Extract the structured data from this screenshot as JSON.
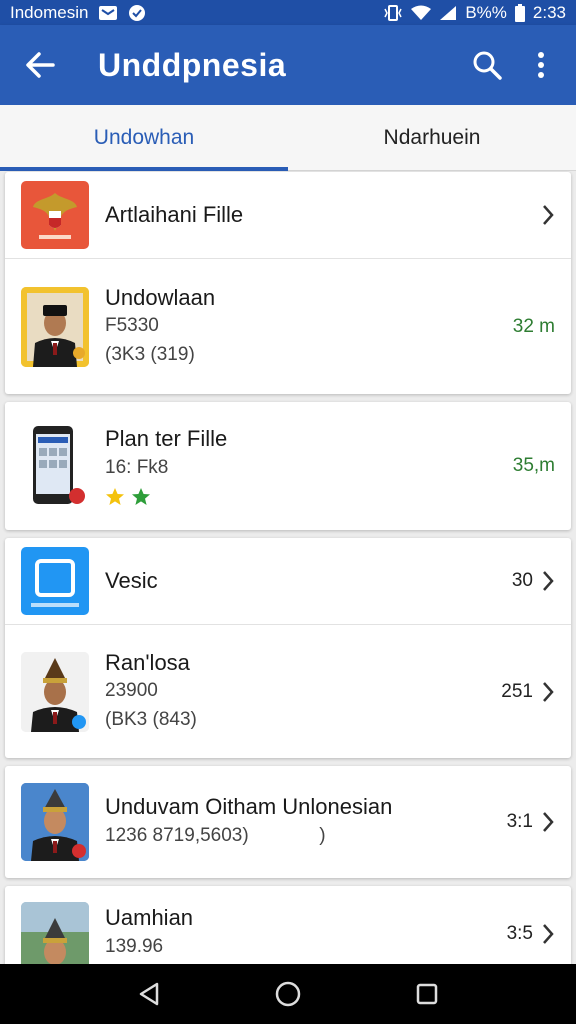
{
  "status_bar": {
    "carrier": "Indomesin",
    "battery": "B%%",
    "time": "2:33"
  },
  "app_bar": {
    "title": "Unddpnesia"
  },
  "tabs": [
    {
      "label": "Undowhan",
      "active": true
    },
    {
      "label": "Ndarhuein",
      "active": false
    }
  ],
  "cards": [
    {
      "rows": [
        {
          "title": "Artlaihani Fille",
          "trailing": "",
          "icon": "garuda-emblem"
        }
      ]
    },
    {
      "rows": [
        {
          "title": "Undowlaan",
          "line1": "F5330",
          "line2": "(3K3 (319)",
          "trailing": "32 m",
          "icon": "person-peci-portrait"
        }
      ]
    },
    {
      "rows": [
        {
          "title": "Plan ter Fille",
          "line1": "16: Fk8",
          "trailing": "35,m",
          "icon": "smartphone",
          "stars": [
            "yellow",
            "green"
          ]
        }
      ]
    },
    {
      "rows": [
        {
          "title": "Vesic",
          "trailing": "30",
          "icon": "blue-square-app"
        },
        {
          "title": "Ran'losa",
          "line1": "23900",
          "line2": "(BK3 (843)",
          "trailing": "251",
          "icon": "person-traditional-hat"
        }
      ]
    },
    {
      "rows": [
        {
          "title": "Unduvam Oitham Unlonesian",
          "line1": "1236 8719,5603)",
          "line2_suffix": ")",
          "trailing": "3:1",
          "icon": "person-traditional-hat-blue"
        }
      ]
    },
    {
      "rows": [
        {
          "title": "Uamhian",
          "line1": "139.96",
          "trailing": "3:5",
          "icon": "person-outdoor"
        }
      ]
    }
  ],
  "colors": {
    "primary": "#2a5db6",
    "status": "#1f4fa6",
    "accent_green": "#2e7d32"
  }
}
